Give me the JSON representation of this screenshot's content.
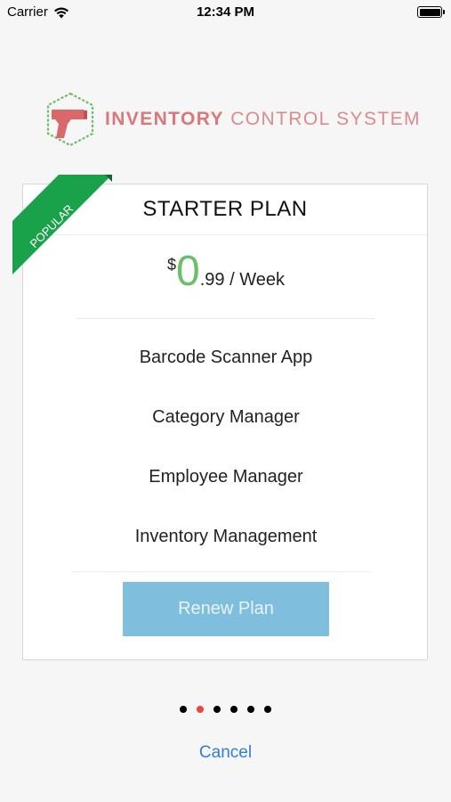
{
  "status_bar": {
    "carrier": "Carrier",
    "time": "12:34 PM",
    "wifi_icon": "wifi-icon",
    "battery_icon": "battery-full-icon"
  },
  "logo": {
    "mark_icon": "barcode-scanner-gun-icon",
    "text_bold": "INVENTORY",
    "text_light": " CONTROL SYSTEM",
    "color": "#d9777a",
    "mark_color": "#6bbf66"
  },
  "plan": {
    "ribbon_label": "POPULAR",
    "ribbon_color": "#19a24a",
    "title": "STARTER PLAN",
    "currency": "$",
    "price_int": "0",
    "price_rest": ".99 / Week",
    "price_color": "#6bbf66",
    "features": [
      "Barcode Scanner App",
      "Category Manager",
      "Employee Manager",
      "Inventory Management"
    ],
    "renew_label": "Renew Plan",
    "renew_color": "#7fbfdd"
  },
  "pager": {
    "count": 6,
    "active_index": 1,
    "active_color": "#e8473c"
  },
  "cancel_label": "Cancel",
  "link_color": "#2f7fd8"
}
